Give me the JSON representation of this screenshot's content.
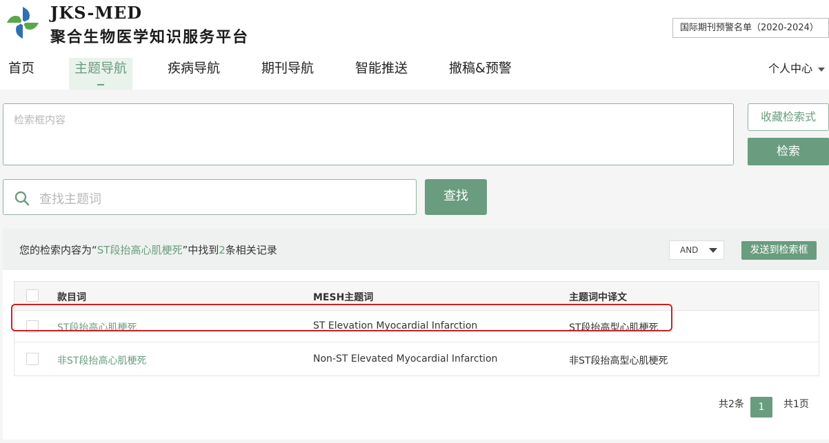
{
  "brand": {
    "name_en": "JKS-MED",
    "name_cn": "聚合生物医学知识服务平台",
    "logo_icon": "pinwheel-logo-icon"
  },
  "header": {
    "warning_list_label": "国际期刊预警名单（2020-2024）"
  },
  "nav": {
    "items": [
      {
        "label": "首页",
        "active": false
      },
      {
        "label": "主题导航",
        "active": true
      },
      {
        "label": "疾病导航",
        "active": false
      },
      {
        "label": "期刊导航",
        "active": false
      },
      {
        "label": "智能推送",
        "active": false
      },
      {
        "label": "撤稿&预警",
        "active": false
      }
    ],
    "user_center": "个人中心"
  },
  "search": {
    "placeholder": "检索框内容",
    "save_button": "收藏检索式",
    "search_button": "检索"
  },
  "topic_search": {
    "placeholder": "查找主题词",
    "find_button": "查找"
  },
  "result": {
    "prefix": "您的检索内容为“",
    "query": "ST段抬高心肌梗死",
    "middle": "”中找到",
    "count": "2",
    "suffix": "条相关记录",
    "operator": "AND",
    "send_button": "发送到检索框"
  },
  "table": {
    "headers": [
      "款目词",
      "MESH主题词",
      "主题词中译文"
    ],
    "rows": [
      {
        "entry": "ST段抬高心肌梗死",
        "mesh": "ST Elevation Myocardial Infarction",
        "translation": "ST段抬高型心肌梗死",
        "highlighted": true
      },
      {
        "entry": "非ST段抬高心肌梗死",
        "mesh": "Non-ST Elevated Myocardial Infarction",
        "translation": "非ST段抬高型心肌梗死",
        "highlighted": false
      }
    ]
  },
  "pagination": {
    "total": "共2条",
    "current_page": "1",
    "total_pages": "共1页"
  },
  "colors": {
    "accent": "#6a9c7f",
    "highlight_border": "#cc1f1f"
  }
}
